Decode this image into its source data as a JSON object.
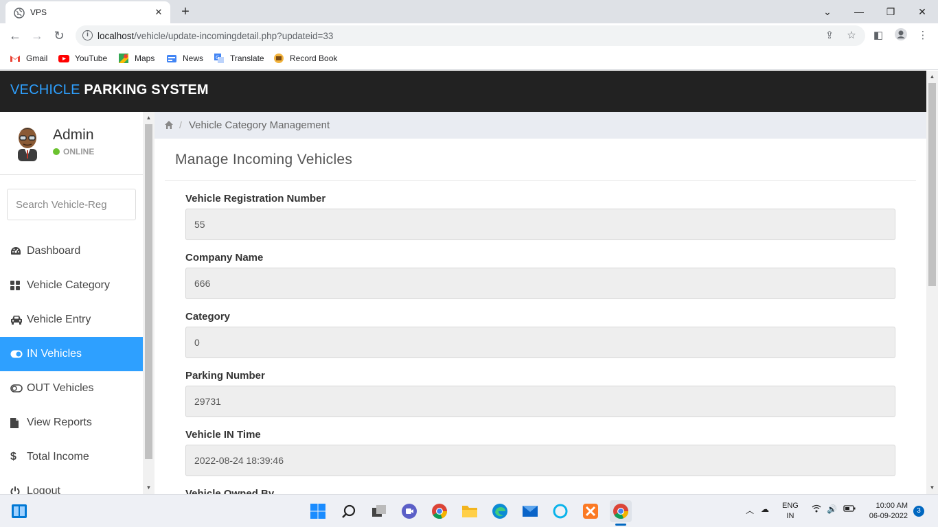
{
  "browser": {
    "tab_title": "VPS",
    "url_host": "localhost",
    "url_path": "/vehicle/update-incomingdetail.php?updateid=33",
    "bookmarks": [
      "Gmail",
      "YouTube",
      "Maps",
      "News",
      "Translate",
      "Record Book"
    ]
  },
  "app": {
    "title_accent": "VECHICLE",
    "title_rest": " PARKING SYSTEM",
    "accent_color": "#2ea0ff"
  },
  "user": {
    "name": "Admin",
    "status": "ONLINE"
  },
  "sidebar": {
    "search_placeholder": "Search Vehicle-Reg",
    "items": [
      {
        "label": "Dashboard",
        "icon": "dashboard-icon"
      },
      {
        "label": "Vehicle Category",
        "icon": "th-large-icon"
      },
      {
        "label": "Vehicle Entry",
        "icon": "car-icon"
      },
      {
        "label": "IN Vehicles",
        "icon": "toggle-on-icon",
        "active": true
      },
      {
        "label": "OUT Vehicles",
        "icon": "toggle-off-icon"
      },
      {
        "label": "View Reports",
        "icon": "file-icon"
      },
      {
        "label": "Total Income",
        "icon": "dollar-icon"
      },
      {
        "label": "Logout",
        "icon": "power-icon"
      }
    ]
  },
  "breadcrumb": {
    "current": "Vehicle Category Management"
  },
  "panel": {
    "title": "Manage Incoming Vehicles",
    "fields": [
      {
        "label": "Vehicle Registration Number",
        "value": "55"
      },
      {
        "label": "Company Name",
        "value": "666"
      },
      {
        "label": "Category",
        "value": "0"
      },
      {
        "label": "Parking Number",
        "value": "29731"
      },
      {
        "label": "Vehicle IN Time",
        "value": "2022-08-24 18:39:46"
      },
      {
        "label": "Vehicle Owned By",
        "value": ""
      }
    ]
  },
  "taskbar": {
    "lang_line1": "ENG",
    "lang_line2": "IN",
    "time": "10:00 AM",
    "date": "06-09-2022",
    "notifications": "3"
  }
}
